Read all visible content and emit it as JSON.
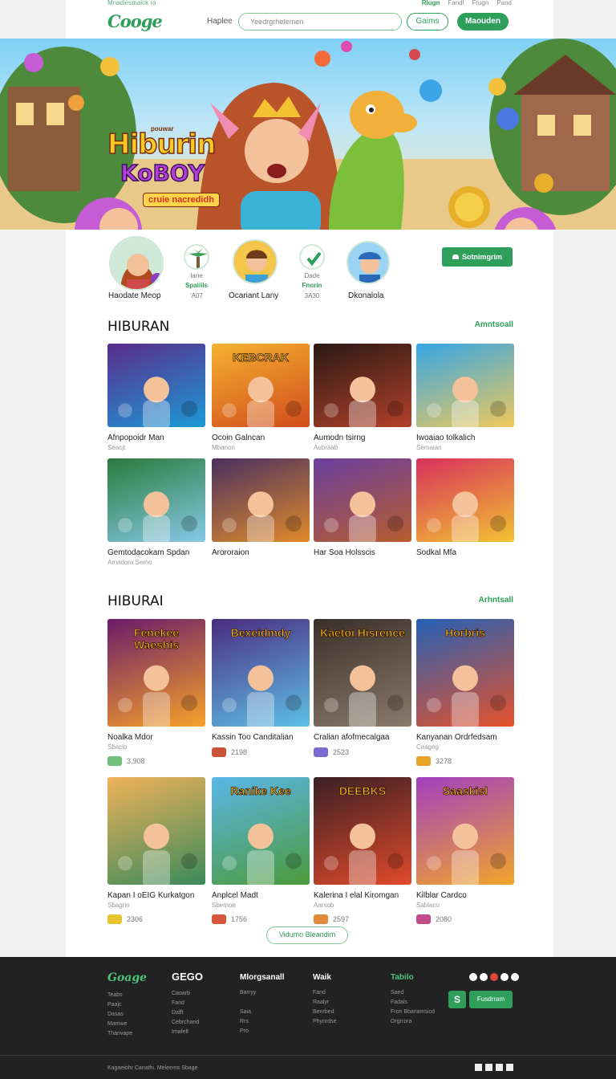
{
  "topstrip": {
    "left_text": "Mnadiesmaick ra",
    "right_links": [
      "Rlugn",
      "Fandl",
      "Frugn",
      "Pand"
    ]
  },
  "header": {
    "logo": "Cooge",
    "nav_label": "Haplee",
    "search_placeholder": "Yeedrgrhetemen",
    "games_button": "Gaims",
    "primary_button": "Maouden"
  },
  "hero": {
    "kicker": "pouwar",
    "title_line1": "Hiburin",
    "title_line2": "KoBOY",
    "subtitle": "cruie nacredidh"
  },
  "profiles": [
    {
      "name": "Haodate Meop",
      "top": "",
      "sub": "",
      "icon": "woman-portrait-icon"
    },
    {
      "name": "",
      "top": "Iane",
      "sub": "Spaiiils",
      "extra": "'A07",
      "icon": "palm-tree-icon"
    },
    {
      "name": "Ocariant Lany",
      "top": "",
      "sub": "",
      "icon": "man-portrait-icon"
    },
    {
      "name": "",
      "top": "Dade",
      "sub": "Fnorin",
      "extra": "3A30",
      "icon": "check-badge-icon"
    },
    {
      "name": "Dkonalola",
      "top": "",
      "sub": "",
      "icon": "cap-portrait-icon"
    }
  ],
  "signup_button": "Sotnimgrim",
  "section1": {
    "title": "HIBURAN",
    "link": "Amntsoall",
    "cards": [
      {
        "name": "Afnpopoidr Man",
        "sub": "Seacjt",
        "thumb_title": "",
        "colors": [
          "#5a2b8c",
          "#1c9ad6"
        ]
      },
      {
        "name": "Ocoin Galncan",
        "sub": "Mbanon",
        "thumb_title": "KEBCRAK",
        "colors": [
          "#f5b230",
          "#d24b1c"
        ]
      },
      {
        "name": "Aumodn tsirng",
        "sub": "Aubraab",
        "thumb_title": "",
        "colors": [
          "#2a1a14",
          "#b3402a"
        ]
      },
      {
        "name": "Iwoaiao tolkalich",
        "sub": "Semaian",
        "thumb_title": "",
        "colors": [
          "#35a6e6",
          "#f0c95a"
        ]
      },
      {
        "name": "Gemtodacokam Spdan",
        "sub": "Amadora Semo",
        "thumb_title": "",
        "colors": [
          "#2b7a3a",
          "#86c9e8"
        ]
      },
      {
        "name": "Arororaion",
        "sub": "",
        "thumb_title": "",
        "colors": [
          "#4a3060",
          "#e08a2a"
        ]
      },
      {
        "name": "Har Soa Holsscis",
        "sub": "",
        "thumb_title": "",
        "colors": [
          "#6a3fa0",
          "#b85d2e"
        ]
      },
      {
        "name": "Sodkal Mfa",
        "sub": "",
        "thumb_title": "",
        "colors": [
          "#d8305c",
          "#f2c232"
        ]
      }
    ]
  },
  "section2": {
    "title": "HIBURAI",
    "link": "Arhntsall",
    "cards": [
      {
        "name": "Noalka Mdor",
        "sub": "Sbaclo",
        "price": "3,908",
        "thumb_title": "Fenekee Waeshis",
        "colors": [
          "#6a1c6a",
          "#f7a12a"
        ],
        "ico": "#6fbf7a"
      },
      {
        "name": "Kassin Too Canditalian",
        "sub": "",
        "price": "2198",
        "thumb_title": "Bexeidmdy",
        "colors": [
          "#4a2b80",
          "#5ec0e6"
        ],
        "ico": "#c9543a"
      },
      {
        "name": "Cralian afofmecalgaa",
        "sub": "",
        "price": "2523",
        "thumb_title": "Kaetoi Hisrence",
        "colors": [
          "#3a2f2a",
          "#8a7a6a"
        ],
        "ico": "#7b6ad0"
      },
      {
        "name": "Kanyanan Ordrfedsam",
        "sub": "Ceagng",
        "price": "3278",
        "thumb_title": "Horbris",
        "colors": [
          "#2461b8",
          "#e6522a"
        ],
        "ico": "#e6a52a"
      },
      {
        "name": "Kapan I oEIG Kurkatgon",
        "sub": "Sbagrio",
        "price": "2306",
        "thumb_title": "",
        "colors": [
          "#f0b25a",
          "#3a8a5a"
        ],
        "ico": "#e8c430"
      },
      {
        "name": "Anplcel Madt",
        "sub": "Sbemon",
        "price": "1756",
        "thumb_title": "Ranike Kee",
        "colors": [
          "#5ab6e8",
          "#4c9a3a"
        ],
        "ico": "#d6563a"
      },
      {
        "name": "Kalerina I elal Kiromgan",
        "sub": "Aarsob",
        "price": "2597",
        "thumb_title": "DEEBKS",
        "colors": [
          "#3b1f24",
          "#e04a2a"
        ],
        "ico": "#e0893a"
      },
      {
        "name": "Kilblar Cardco",
        "sub": "Sablaco",
        "price": "2080",
        "thumb_title": "Saaskisl",
        "colors": [
          "#a23fc0",
          "#f2a52a"
        ],
        "ico": "#c44a8c"
      }
    ]
  },
  "load_more": "Vidumo Bleandim",
  "footer": {
    "logo": "Goage",
    "col1": {
      "heading": "",
      "items": [
        "Teabs",
        "Paajc",
        "Dasas",
        "Mamwe",
        "Thanvape"
      ]
    },
    "col2": {
      "heading": "GEGO",
      "items": [
        "Caoarb",
        "Fand",
        "Dafft",
        "Cebrchand",
        "Imafelt"
      ]
    },
    "col3": {
      "heading": "Mlorgsanall",
      "items": [
        "Barryy",
        "",
        "Saia",
        "Rrs",
        "Pro"
      ]
    },
    "col4": {
      "heading": "Waik",
      "items": [
        "Fand",
        "Raalyr",
        "Benrbed",
        "Phynrdse"
      ]
    },
    "col5": {
      "heading": "Tabilo",
      "items": [
        "Saed",
        "Fadals",
        "Fron Bbariamsicd",
        "Orgrrora"
      ]
    },
    "button": "Fusdrram",
    "copyright": "Kagaeiohr Canathi. Meleems Sbage"
  }
}
